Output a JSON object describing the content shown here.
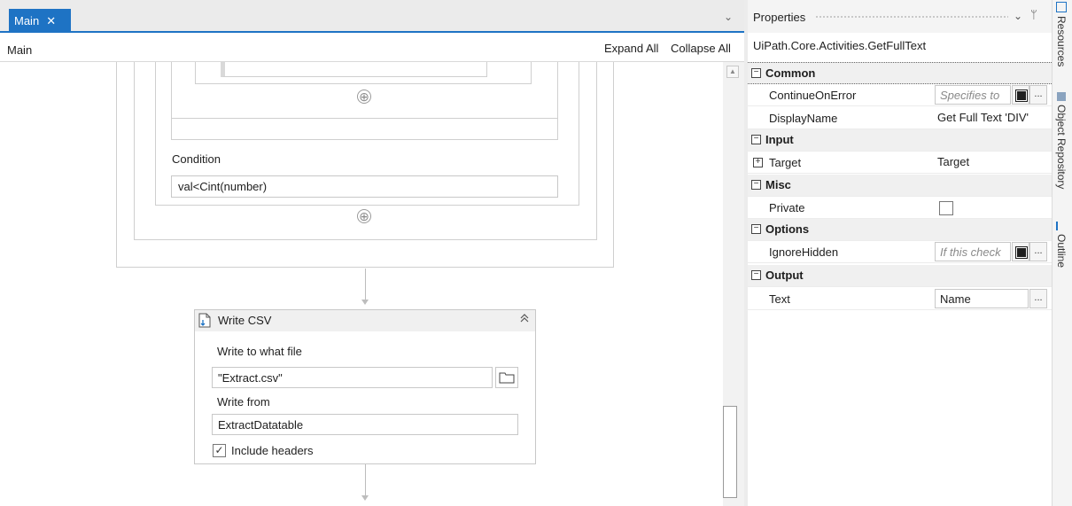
{
  "designer": {
    "tab_label": "Main",
    "tab_close": "✕",
    "tab_dropdown": "⌄",
    "breadcrumb": "Main",
    "expand_all": "Expand All",
    "collapse_all": "Collapse All"
  },
  "canvas": {
    "condition_label": "Condition",
    "condition_value": "val<Cint(number)",
    "add_icon": "⊕",
    "write_csv": {
      "title": "Write CSV",
      "icon": "write-csv-icon",
      "collapse_icon": "≈",
      "write_to_label": "Write to what file",
      "file_value": "\"Extract.csv\"",
      "write_from_label": "Write from",
      "from_value": "ExtractDatatable",
      "include_headers_label": "Include headers",
      "include_headers_checked": true,
      "check_mark": "✓"
    }
  },
  "properties": {
    "title": "Properties",
    "dropdown": "⌄",
    "pin": "ᛘ",
    "activity_type": "UiPath.Core.Activities.GetFullText",
    "collapse_sign": "−",
    "expand_sign": "+",
    "dots": "...",
    "categories": {
      "common": "Common",
      "input": "Input",
      "misc": "Misc",
      "options": "Options",
      "output": "Output"
    },
    "rows": {
      "continue_on_error": {
        "name": "ContinueOnError",
        "hint": "Specifies to"
      },
      "display_name": {
        "name": "DisplayName",
        "value": "Get Full Text 'DIV'"
      },
      "target": {
        "name": "Target",
        "value": "Target"
      },
      "private": {
        "name": "Private",
        "checked": false
      },
      "ignore_hidden": {
        "name": "IgnoreHidden",
        "hint": "If this check"
      },
      "text": {
        "name": "Text",
        "value": "Name"
      }
    }
  },
  "side_tabs": {
    "resources": "Resources",
    "object_repository": "Object Repository",
    "outline": "Outline"
  },
  "colors": {
    "accent": "#1e73c4",
    "category_bg": "#f0f0f0"
  }
}
